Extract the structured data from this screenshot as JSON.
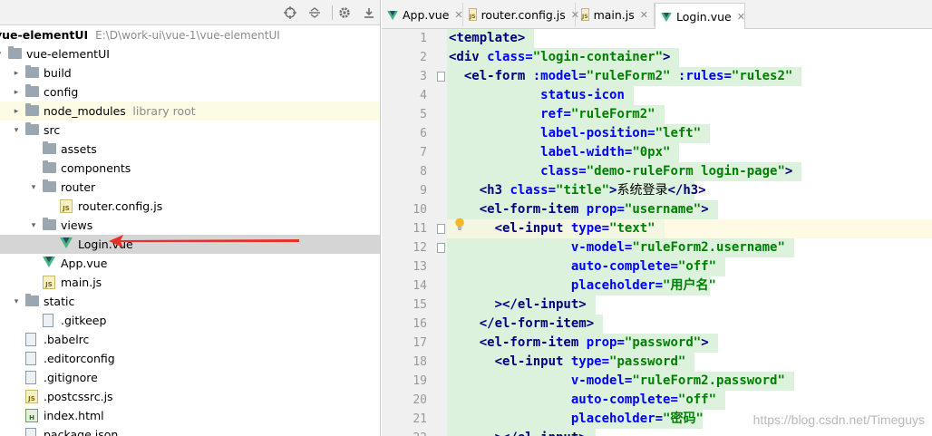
{
  "project_panel": {
    "root": {
      "name": "vue-elementUI",
      "path": "E:\\D\\work-ui\\vue-1\\vue-elementUI"
    },
    "tree": [
      {
        "label": "vue-elementUI",
        "type": "folder",
        "depth": 0,
        "expanded": true
      },
      {
        "label": "build",
        "type": "folder",
        "depth": 1,
        "expanded": false
      },
      {
        "label": "config",
        "type": "folder",
        "depth": 1,
        "expanded": false
      },
      {
        "label": "node_modules",
        "note": "library root",
        "type": "folder",
        "depth": 1,
        "expanded": false,
        "highlight": true
      },
      {
        "label": "src",
        "type": "folder",
        "depth": 1,
        "expanded": true
      },
      {
        "label": "assets",
        "type": "folder",
        "depth": 2
      },
      {
        "label": "components",
        "type": "folder",
        "depth": 2
      },
      {
        "label": "router",
        "type": "folder",
        "depth": 2,
        "expanded": true
      },
      {
        "label": "router.config.js",
        "type": "js",
        "depth": 3
      },
      {
        "label": "views",
        "type": "folder",
        "depth": 2,
        "expanded": true
      },
      {
        "label": "Login.vue",
        "type": "vue",
        "depth": 3,
        "selected": true
      },
      {
        "label": "App.vue",
        "type": "vue",
        "depth": 2
      },
      {
        "label": "main.js",
        "type": "js",
        "depth": 2
      },
      {
        "label": "static",
        "type": "folder",
        "depth": 1,
        "expanded": true
      },
      {
        "label": ".gitkeep",
        "type": "file",
        "depth": 2
      },
      {
        "label": ".babelrc",
        "type": "file",
        "depth": 1
      },
      {
        "label": ".editorconfig",
        "type": "file",
        "depth": 1
      },
      {
        "label": ".gitignore",
        "type": "file",
        "depth": 1
      },
      {
        "label": ".postcssrc.js",
        "type": "js",
        "depth": 1
      },
      {
        "label": "index.html",
        "type": "html",
        "depth": 1
      },
      {
        "label": "package.json",
        "type": "file",
        "depth": 1
      }
    ],
    "toolbar_icons": [
      "crosshair-icon",
      "collapse-icon",
      "gear-icon",
      "hide-icon"
    ],
    "annotation_color": "#e8302a"
  },
  "editor": {
    "tabs": [
      {
        "label": "App.vue",
        "icon": "vue"
      },
      {
        "label": "router.config.js",
        "icon": "js"
      },
      {
        "label": "main.js",
        "icon": "js"
      },
      {
        "label": "Login.vue",
        "icon": "vue",
        "active": true
      }
    ],
    "current_line": 11,
    "lines": [
      {
        "n": "1",
        "indent": 0,
        "parts": [
          [
            "t",
            "<template>"
          ]
        ]
      },
      {
        "n": "2",
        "indent": 0,
        "parts": [
          [
            "t",
            "<div "
          ],
          [
            "a",
            "class="
          ],
          [
            "v",
            "\"login-container\""
          ],
          [
            "t",
            ">"
          ]
        ]
      },
      {
        "n": "3",
        "indent": 2,
        "parts": [
          [
            "t",
            "<el-form "
          ],
          [
            "a",
            ":model="
          ],
          [
            "v",
            "\"ruleForm2\" "
          ],
          [
            "a",
            ":rules="
          ],
          [
            "v",
            "\"rules2\""
          ]
        ]
      },
      {
        "n": "4",
        "indent": 12,
        "parts": [
          [
            "a",
            "status-icon"
          ]
        ]
      },
      {
        "n": "5",
        "indent": 12,
        "parts": [
          [
            "a",
            "ref="
          ],
          [
            "v",
            "\"ruleForm2\""
          ]
        ]
      },
      {
        "n": "6",
        "indent": 12,
        "parts": [
          [
            "a",
            "label-position="
          ],
          [
            "v",
            "\"left\""
          ]
        ]
      },
      {
        "n": "7",
        "indent": 12,
        "parts": [
          [
            "a",
            "label-width="
          ],
          [
            "v",
            "\"0px\""
          ]
        ]
      },
      {
        "n": "8",
        "indent": 12,
        "parts": [
          [
            "a",
            "class="
          ],
          [
            "v",
            "\"demo-ruleForm login-page\""
          ],
          [
            "t",
            ">"
          ]
        ]
      },
      {
        "n": "9",
        "indent": 4,
        "parts": [
          [
            "t",
            "<h3 "
          ],
          [
            "a",
            "class="
          ],
          [
            "v",
            "\"title\""
          ],
          [
            "t",
            ">"
          ],
          [
            "x",
            "系统登录"
          ],
          [
            "t",
            "</h3>"
          ]
        ]
      },
      {
        "n": "10",
        "indent": 4,
        "parts": [
          [
            "t",
            "<el-form-item "
          ],
          [
            "a",
            "prop="
          ],
          [
            "v",
            "\"username\""
          ],
          [
            "t",
            ">"
          ]
        ]
      },
      {
        "n": "11",
        "indent": 6,
        "parts": [
          [
            "t",
            "<el-input "
          ],
          [
            "a",
            "type="
          ],
          [
            "v",
            "\"text\""
          ]
        ]
      },
      {
        "n": "12",
        "indent": 16,
        "parts": [
          [
            "a",
            "v-model="
          ],
          [
            "v",
            "\"ruleForm2.username\""
          ]
        ]
      },
      {
        "n": "13",
        "indent": 16,
        "parts": [
          [
            "a",
            "auto-complete="
          ],
          [
            "v",
            "\"off\""
          ]
        ]
      },
      {
        "n": "14",
        "indent": 16,
        "parts": [
          [
            "a",
            "placeholder="
          ],
          [
            "v",
            "\"用户名\""
          ]
        ]
      },
      {
        "n": "15",
        "indent": 6,
        "parts": [
          [
            "t",
            "></el-input>"
          ]
        ]
      },
      {
        "n": "16",
        "indent": 4,
        "parts": [
          [
            "t",
            "</el-form-item>"
          ]
        ]
      },
      {
        "n": "17",
        "indent": 4,
        "parts": [
          [
            "t",
            "<el-form-item "
          ],
          [
            "a",
            "prop="
          ],
          [
            "v",
            "\"password\""
          ],
          [
            "t",
            ">"
          ]
        ]
      },
      {
        "n": "18",
        "indent": 6,
        "parts": [
          [
            "t",
            "<el-input "
          ],
          [
            "a",
            "type="
          ],
          [
            "v",
            "\"password\""
          ]
        ]
      },
      {
        "n": "19",
        "indent": 16,
        "parts": [
          [
            "a",
            "v-model="
          ],
          [
            "v",
            "\"ruleForm2.password\""
          ]
        ]
      },
      {
        "n": "20",
        "indent": 16,
        "parts": [
          [
            "a",
            "auto-complete="
          ],
          [
            "v",
            "\"off\""
          ]
        ]
      },
      {
        "n": "21",
        "indent": 16,
        "parts": [
          [
            "a",
            "placeholder="
          ],
          [
            "v",
            "\"密码\""
          ]
        ]
      },
      {
        "n": "22",
        "indent": 6,
        "parts": [
          [
            "t",
            "></el-input>"
          ]
        ]
      }
    ],
    "watermark": "https://blog.csdn.net/Timeguys"
  }
}
